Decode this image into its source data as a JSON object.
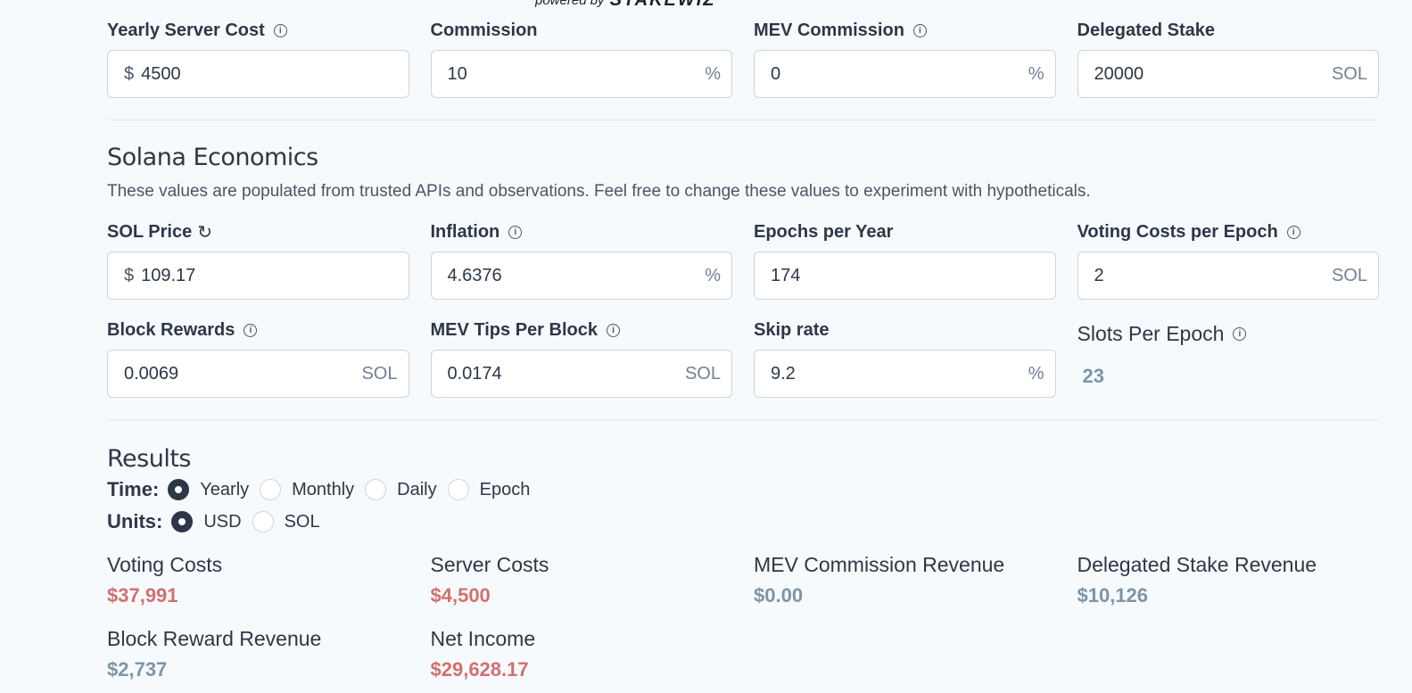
{
  "powered": {
    "text": "powered by",
    "brand": "STAKEWIZ"
  },
  "operator": {
    "fields": [
      {
        "label": "Yearly Server Cost",
        "info": true,
        "prefix": "$",
        "value": "4500",
        "suffix": ""
      },
      {
        "label": "Commission",
        "info": false,
        "prefix": "",
        "value": "10",
        "suffix": "%"
      },
      {
        "label": "MEV Commission",
        "info": true,
        "prefix": "",
        "value": "0",
        "suffix": "%"
      },
      {
        "label": "Delegated Stake",
        "info": false,
        "prefix": "",
        "value": "20000",
        "suffix": "SOL"
      }
    ]
  },
  "economics": {
    "title": "Solana Economics",
    "description": "These values are populated from trusted APIs and observations. Feel free to change these values to experiment with hypotheticals.",
    "row1": [
      {
        "label": "SOL Price",
        "icon": "refresh-icon",
        "refresh_glyph": "↻",
        "prefix": "$",
        "value": "109.17",
        "suffix": ""
      },
      {
        "label": "Inflation",
        "info": true,
        "prefix": "",
        "value": "4.6376",
        "suffix": "%"
      },
      {
        "label": "Epochs per Year",
        "info": false,
        "prefix": "",
        "value": "174",
        "suffix": ""
      },
      {
        "label": "Voting Costs per Epoch",
        "info": true,
        "prefix": "",
        "value": "2",
        "suffix": "SOL"
      }
    ],
    "row2": [
      {
        "label": "Block Rewards",
        "info": true,
        "prefix": "",
        "value": "0.0069",
        "suffix": "SOL"
      },
      {
        "label": "MEV Tips Per Block",
        "info": true,
        "prefix": "",
        "value": "0.0174",
        "suffix": "SOL"
      },
      {
        "label": "Skip rate",
        "info": false,
        "prefix": "",
        "value": "9.2",
        "suffix": "%"
      }
    ],
    "slots": {
      "label": "Slots Per Epoch",
      "value": "23"
    }
  },
  "results": {
    "title": "Results",
    "time": {
      "label": "Time:",
      "options": [
        "Yearly",
        "Monthly",
        "Daily",
        "Epoch"
      ],
      "selected": "Yearly"
    },
    "units": {
      "label": "Units:",
      "options": [
        "USD",
        "SOL"
      ],
      "selected": "USD"
    },
    "row1": [
      {
        "label": "Voting Costs",
        "value": "$37,991",
        "tone": "neg"
      },
      {
        "label": "Server Costs",
        "value": "$4,500",
        "tone": "neg"
      },
      {
        "label": "MEV Commission Revenue",
        "value": "$0.00",
        "tone": "pos"
      },
      {
        "label": "Delegated Stake Revenue",
        "value": "$10,126",
        "tone": "pos"
      }
    ],
    "row2": [
      {
        "label": "Block Reward Revenue",
        "value": "$2,737",
        "tone": "pos"
      },
      {
        "label": "Net Income",
        "value": "$29,628.17",
        "tone": "neg"
      }
    ]
  },
  "colors": {
    "negative": "#d27070",
    "positive": "#7c95a8",
    "text": "#2d3748",
    "background": "#f7fafc"
  },
  "info_glyph": "i"
}
